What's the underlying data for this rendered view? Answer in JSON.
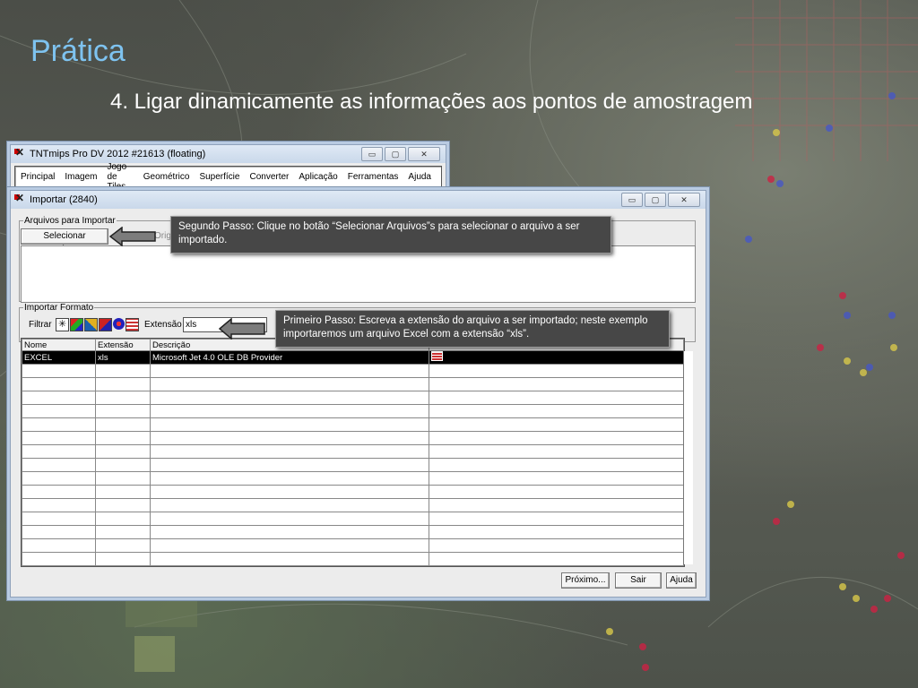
{
  "slide": {
    "title": "Prática",
    "subtitle": "4. Ligar dinamicamente as informações aos pontos de amostragem"
  },
  "main_window": {
    "title": "TNTmips Pro DV 2012  #21613 (floating)",
    "menu": [
      "Principal",
      "Imagem",
      "Jogo de Tiles",
      "Geométrico",
      "Superfície",
      "Converter",
      "Aplicação",
      "Ferramentas",
      "Ajuda"
    ],
    "controls": {
      "minimize": "▭",
      "maximize": "▢",
      "close": "✕"
    }
  },
  "import_window": {
    "title": "Importar (2840)",
    "controls": {
      "minimize": "▭",
      "maximize": "▢",
      "close": "✕"
    },
    "files_group": {
      "legend": "Arquivos para Importar",
      "select_button": "Selecionar Arquivos...",
      "hidden_label": "Orig"
    },
    "format_group": {
      "legend": "Importar Formato",
      "filter_label": "Filtrar",
      "extension_label": "Extensão",
      "extension_value": "xls",
      "filter_icons": [
        "vector-filter-icon",
        "raster-filter-icon",
        "cad-filter-icon",
        "tin-filter-icon",
        "shape-filter-icon",
        "database-filter-icon"
      ]
    },
    "table": {
      "columns": [
        "Nome",
        "Extensão",
        "Descrição",
        ""
      ],
      "rows": [
        [
          "EXCEL",
          "xls",
          "Microsoft Jet 4.0 OLE DB Provider",
          ""
        ]
      ],
      "empty_rows": 15
    },
    "buttons": {
      "next": "Próximo...",
      "exit": "Sair",
      "help": "Ajuda"
    }
  },
  "callouts": {
    "step2": "Segundo Passo: Clique no botão “Selecionar Arquivos”s para selecionar o arquivo a ser importado.",
    "step1": "Primeiro Passo: Escreva a extensão do arquivo a ser importado; neste exemplo importaremos um arquivo  Excel com a extensão “xls”."
  }
}
